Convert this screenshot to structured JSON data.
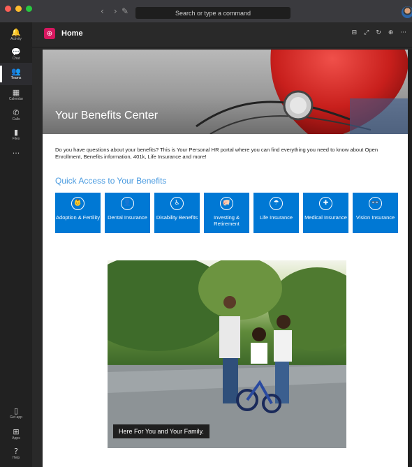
{
  "titlebar": {
    "search_placeholder": "Search or type a command",
    "back_glyph": "‹",
    "forward_glyph": "›",
    "compose_glyph": "✎"
  },
  "rail": {
    "items": [
      {
        "label": "Activity",
        "icon": "bell-icon",
        "glyph": "🔔"
      },
      {
        "label": "Chat",
        "icon": "chat-icon",
        "glyph": "💬"
      },
      {
        "label": "Teams",
        "icon": "teams-icon",
        "glyph": "👥"
      },
      {
        "label": "Calendar",
        "icon": "calendar-icon",
        "glyph": "▦"
      },
      {
        "label": "Calls",
        "icon": "phone-icon",
        "glyph": "✆"
      },
      {
        "label": "Files",
        "icon": "file-icon",
        "glyph": "▮"
      },
      {
        "label": "",
        "icon": "more-icon",
        "glyph": "···"
      }
    ],
    "bottom": [
      {
        "label": "Get app",
        "icon": "device-icon",
        "glyph": "▯"
      },
      {
        "label": "Apps",
        "icon": "apps-icon",
        "glyph": "⊞"
      },
      {
        "label": "Help",
        "icon": "help-icon",
        "glyph": "?"
      }
    ]
  },
  "app": {
    "title": "Home",
    "logo_glyph": "⊕",
    "header_icons": [
      "⊟",
      "⤢",
      "↻",
      "⊕",
      "···"
    ]
  },
  "page": {
    "hero_title": "Your Benefits Center",
    "intro": "Do you have questions about your benefits?  This is Your Personal HR portal where you can find everything you need to know about Open Enrollment, Benefits information, 401k, Life Insurance and more!",
    "section_title": "Quick Access to Your Benefits",
    "tiles": [
      {
        "label": "Adoption & Fertility",
        "icon": "baby-icon",
        "glyph": "👶"
      },
      {
        "label": "Dental Insurance",
        "icon": "person-icon",
        "glyph": "👤"
      },
      {
        "label": "Disability Benefits",
        "icon": "wheelchair-icon",
        "glyph": "♿"
      },
      {
        "label": "Investing & Retirement",
        "icon": "piggy-bank-icon",
        "glyph": "🐖"
      },
      {
        "label": "Life Insurance",
        "icon": "umbrella-icon",
        "glyph": "☂"
      },
      {
        "label": "Medical Insurance",
        "icon": "medical-icon",
        "glyph": "✚"
      },
      {
        "label": "Vision Insurance",
        "icon": "glasses-icon",
        "glyph": "👓"
      }
    ],
    "photo_caption": "Here For You and Your Family."
  },
  "colors": {
    "accent": "#0078d4",
    "app_logo": "#d6175f",
    "section_title": "#4a9be0"
  }
}
